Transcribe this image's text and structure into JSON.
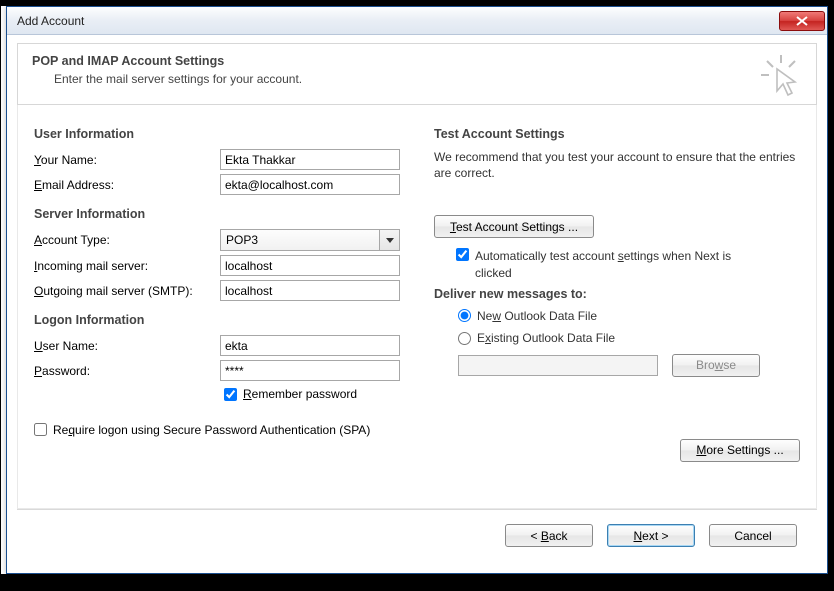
{
  "window": {
    "title": "Add Account"
  },
  "header": {
    "title": "POP and IMAP Account Settings",
    "subtitle": "Enter the mail server settings for your account."
  },
  "left": {
    "user_info_hdr": "User Information",
    "your_name_lbl": "our Name:",
    "your_name_u": "Y",
    "your_name_val": "Ekta Thakkar",
    "email_lbl": "mail Address:",
    "email_u": "E",
    "email_val": "ekta@localhost.com",
    "server_info_hdr": "Server Information",
    "acct_type_lbl": "ccount Type:",
    "acct_type_u": "A",
    "acct_type_val": "POP3",
    "incoming_lbl": "ncoming mail server:",
    "incoming_u": "I",
    "incoming_val": "localhost",
    "outgoing_lbl": "utgoing mail server (SMTP):",
    "outgoing_u": "O",
    "outgoing_val": "localhost",
    "logon_hdr": "Logon Information",
    "user_lbl": "ser Name:",
    "user_u": "U",
    "user_val": "ekta",
    "pass_lbl": "assword:",
    "pass_u": "P",
    "pass_val": "****",
    "remember_lbl": "emember password",
    "remember_u": "R",
    "spa_before": "Re",
    "spa_u": "q",
    "spa_after": "uire logon using Secure Password Authentication (SPA)"
  },
  "right": {
    "test_hdr": "Test Account Settings",
    "test_desc": "We recommend that you test your account to ensure that the entries are correct.",
    "test_btn_u": "T",
    "test_btn_after": "est Account Settings ...",
    "auto_before": "Automatically test account ",
    "auto_u": "s",
    "auto_after": "ettings when Next is clicked",
    "deliver_hdr": "Deliver new messages to:",
    "new_before": "Ne",
    "new_u": "w",
    "new_after": " Outlook Data File",
    "existing_before": "E",
    "existing_u": "x",
    "existing_after": "isting Outlook Data File",
    "browse_before": "Bro",
    "browse_u": "w",
    "browse_after": "se",
    "more_before": "",
    "more_u": "M",
    "more_after": "ore Settings ..."
  },
  "footer": {
    "back_lt": "< ",
    "back_u": "B",
    "back_after": "ack",
    "next_u": "N",
    "next_after": "ext >",
    "cancel": "Cancel"
  }
}
